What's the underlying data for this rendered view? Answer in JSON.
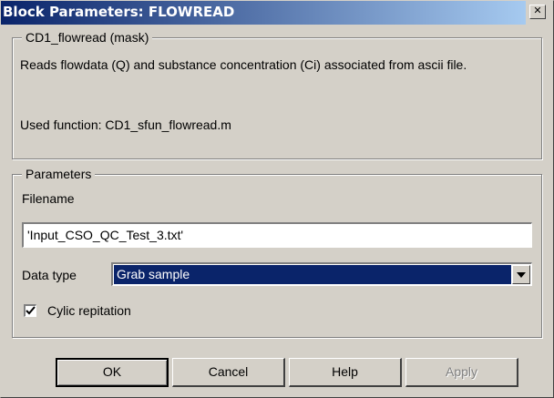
{
  "window": {
    "title": "Block Parameters: FLOWREAD",
    "close_glyph": "✕"
  },
  "description": {
    "group_title": "CD1_flowread (mask)",
    "text": "Reads flowdata (Q) and substance concentration (Ci) associated from ascii file.",
    "used_function": "Used function: CD1_sfun_flowread.m"
  },
  "parameters": {
    "group_title": "Parameters",
    "filename_label": "Filename",
    "filename_value": "'Input_CSO_QC_Test_3.txt'",
    "datatype_label": "Data type",
    "datatype_value": "Grab sample",
    "checkbox_label": "Cylic repitation",
    "checkbox_checked": true
  },
  "buttons": {
    "ok": "OK",
    "cancel": "Cancel",
    "help": "Help",
    "apply": "Apply"
  },
  "colors": {
    "title_start": "#0a246a",
    "title_end": "#a6caf0",
    "selection": "#0a246a",
    "face": "#d4d0c8"
  }
}
